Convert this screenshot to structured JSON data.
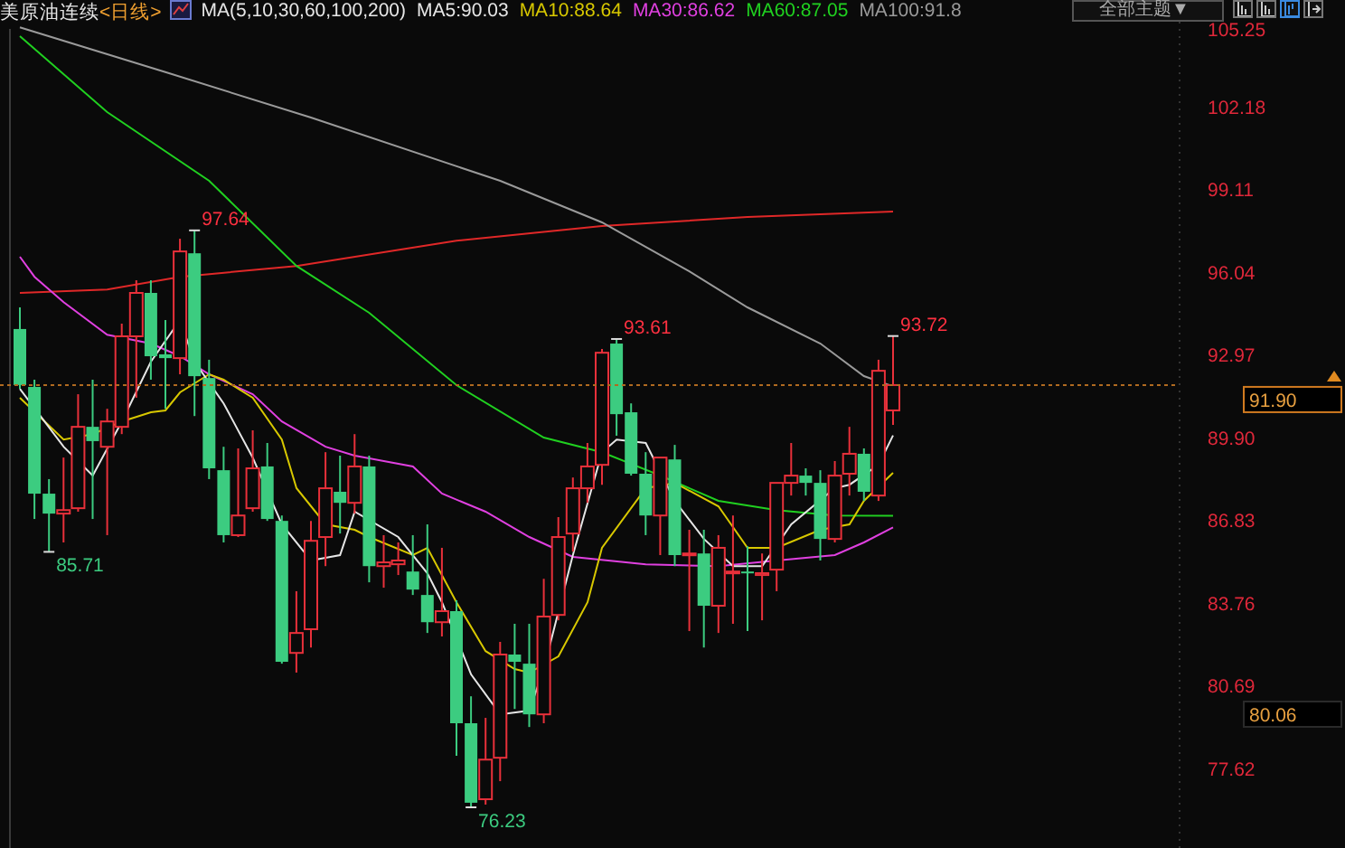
{
  "header": {
    "symbol": "美原油连续",
    "period": "<日线>",
    "indicator": "MA(5,10,30,60,100,200)",
    "legend": [
      {
        "label": "MA5:90.03",
        "color": "#e6e6e6"
      },
      {
        "label": "MA10:88.64",
        "color": "#d8c800"
      },
      {
        "label": "MA30:86.62",
        "color": "#e040e0"
      },
      {
        "label": "MA60:87.05",
        "color": "#20d020"
      },
      {
        "label": "MA100:91.8",
        "color": "#9a9a9a"
      }
    ],
    "theme_dropdown": {
      "label": "全部主题▼"
    },
    "tools": [
      {
        "selected": false
      },
      {
        "selected": false
      },
      {
        "selected": true
      },
      {
        "selected": false
      }
    ]
  },
  "chart": {
    "price_axis": [
      "105.25",
      "102.18",
      "99.11",
      "96.04",
      "92.97",
      "89.90",
      "86.83",
      "83.76",
      "80.69",
      "77.62"
    ],
    "extreme_labels": [
      {
        "kind": "high",
        "label": "97.64"
      },
      {
        "kind": "low",
        "label": "85.71"
      },
      {
        "kind": "high",
        "label": "93.61"
      },
      {
        "kind": "low",
        "label": "76.23"
      },
      {
        "kind": "high",
        "label": "93.72"
      }
    ],
    "price_tags": [
      {
        "kind": "last",
        "label": "91.90"
      },
      {
        "kind": "cursor",
        "label": "80.06"
      }
    ]
  }
}
